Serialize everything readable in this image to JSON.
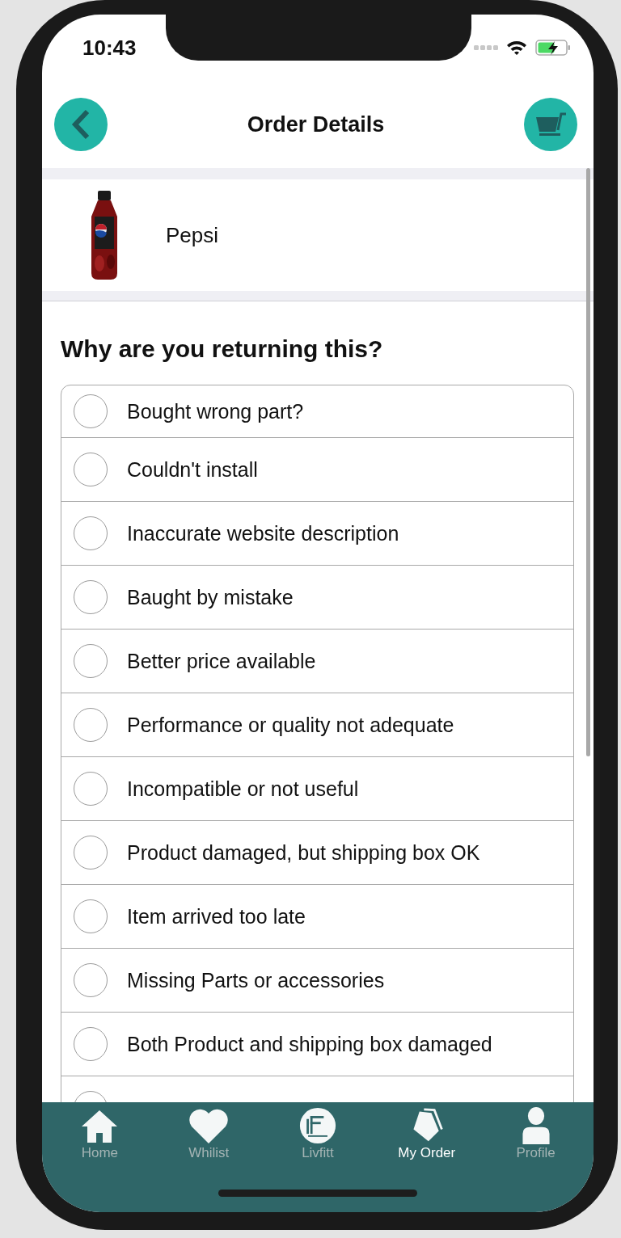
{
  "status_bar": {
    "time": "10:43"
  },
  "header": {
    "title": "Order Details"
  },
  "product": {
    "name": "Pepsi"
  },
  "question": "Why are you returning this?",
  "reasons": [
    {
      "label": "Bought wrong part?",
      "selected": false
    },
    {
      "label": "Couldn't install",
      "selected": false
    },
    {
      "label": "Inaccurate website description",
      "selected": false
    },
    {
      "label": "Baught by mistake",
      "selected": false
    },
    {
      "label": "Better price available",
      "selected": false
    },
    {
      "label": "Performance or quality not adequate",
      "selected": false
    },
    {
      "label": "Incompatible or not useful",
      "selected": false
    },
    {
      "label": "Product damaged, but shipping box OK",
      "selected": false
    },
    {
      "label": "Item arrived too late",
      "selected": false
    },
    {
      "label": "Missing Parts or accessories",
      "selected": false
    },
    {
      "label": "Both Product and shipping box damaged",
      "selected": false
    },
    {
      "selected": false
    }
  ],
  "tabs": [
    {
      "kind": "home",
      "label": "Home",
      "selected": false
    },
    {
      "kind": "heart",
      "label": "Whilist",
      "selected": false
    },
    {
      "kind": "logo",
      "label": "Livfitt",
      "selected": false
    },
    {
      "kind": "tag",
      "label": "My Order",
      "selected": true
    },
    {
      "kind": "person",
      "label": "Profile",
      "selected": false
    }
  ]
}
